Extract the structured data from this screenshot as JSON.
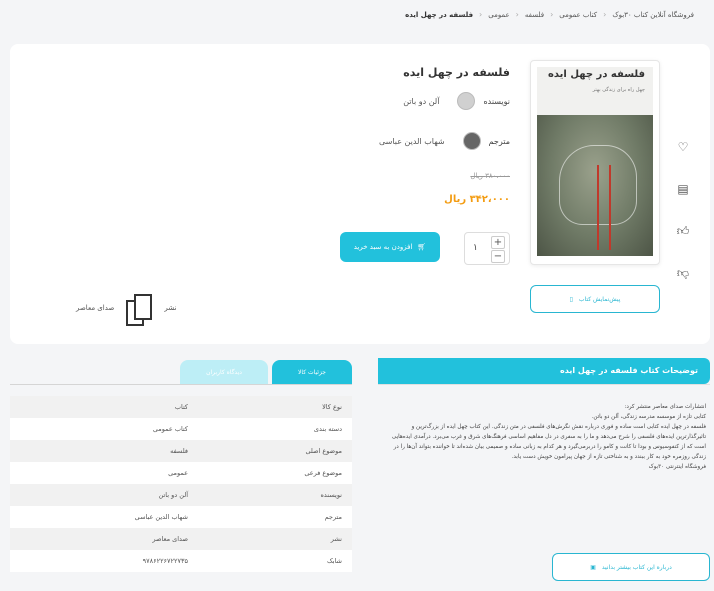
{
  "breadcrumb": [
    "فروشگاه آنلاین کتاب ۳۰بوک",
    "کتاب عمومی",
    "فلسفه",
    "عمومی",
    "فلسفه در چهل ایده"
  ],
  "book": {
    "title": "فلسفه در چهل ایده",
    "cover_title": "فلسفه در چهل ایده",
    "cover_subtitle": "چهل راه برای زندگی بهتر",
    "author_label": "نویسنده",
    "author": "آلن دو باتن",
    "translator_label": "مترجم",
    "translator": "شهاب الدین عباسی",
    "old_price": "۳۸۰،۰۰۰ ریال",
    "price": "۳۴۲،۰۰۰ ریال",
    "quantity": "۱",
    "buy_label": "افزودن به سبد خرید",
    "preview_label": "پیش‌نمایش کتاب",
    "publisher_label": "نشر",
    "publisher": "صدای معاصر"
  },
  "side_icons": [
    "heart-icon",
    "book-icon",
    "thumbs-up-icon",
    "thumbs-down-icon"
  ],
  "description": {
    "heading": "توضیحات کتاب فلسفه در چهل ایده",
    "paragraphs": [
      "انتشارات صدای معاصر منتشر کرد:",
      "کتابی تازه از موسسه مدرسه زندگی، آلن دو باتن.",
      "فلسفه در چهل ایده کتابی است ساده و فوری درباره نقش نگرش‌های فلسفی در متن زندگی. این کتاب چهل ایده از بزرگ‌ترین و تاثیرگذارترین ایده‌های فلسفی را شرح می‌دهد و ما را به سفری در دل مفاهیم اساسی فرهنگ‌های شرق و غرب می‌برد. درآمدی ایده‌هایی است که از کنفوسیوس و بودا تا کانت و کامو را دربرمی‌گیرد و هر کدام به زبانی ساده و صمیمی بیان شده‌اند تا خواننده بتواند آن‌ها را در زندگی روزمره خود به کار ببندد و به شناختی تازه از جهان پیرامون خویش دست یابد.",
      "فروشگاه اینترنتی ۳۰بوک"
    ],
    "more_label": "درباره این کتاب بیشتر بدانید"
  },
  "tabs": {
    "details": "جزئیات کالا",
    "comments": "دیدگاه کاربران"
  },
  "details_table": [
    {
      "k": "نوع کالا",
      "v": "کتاب"
    },
    {
      "k": "دسته بندی",
      "v": "کتاب عمومی"
    },
    {
      "k": "موضوع اصلی",
      "v": "فلسفه"
    },
    {
      "k": "موضوع فرعی",
      "v": "عمومی"
    },
    {
      "k": "نویسنده",
      "v": "آلن دو باتن"
    },
    {
      "k": "مترجم",
      "v": "شهاب الدین عباسی"
    },
    {
      "k": "نشر",
      "v": "صدای معاصر"
    },
    {
      "k": "شابک",
      "v": "۹۷۸۶۲۲۶۷۲۲۷۳۵"
    }
  ],
  "colors": {
    "accent": "#22c1dc",
    "price": "#f39c12"
  }
}
